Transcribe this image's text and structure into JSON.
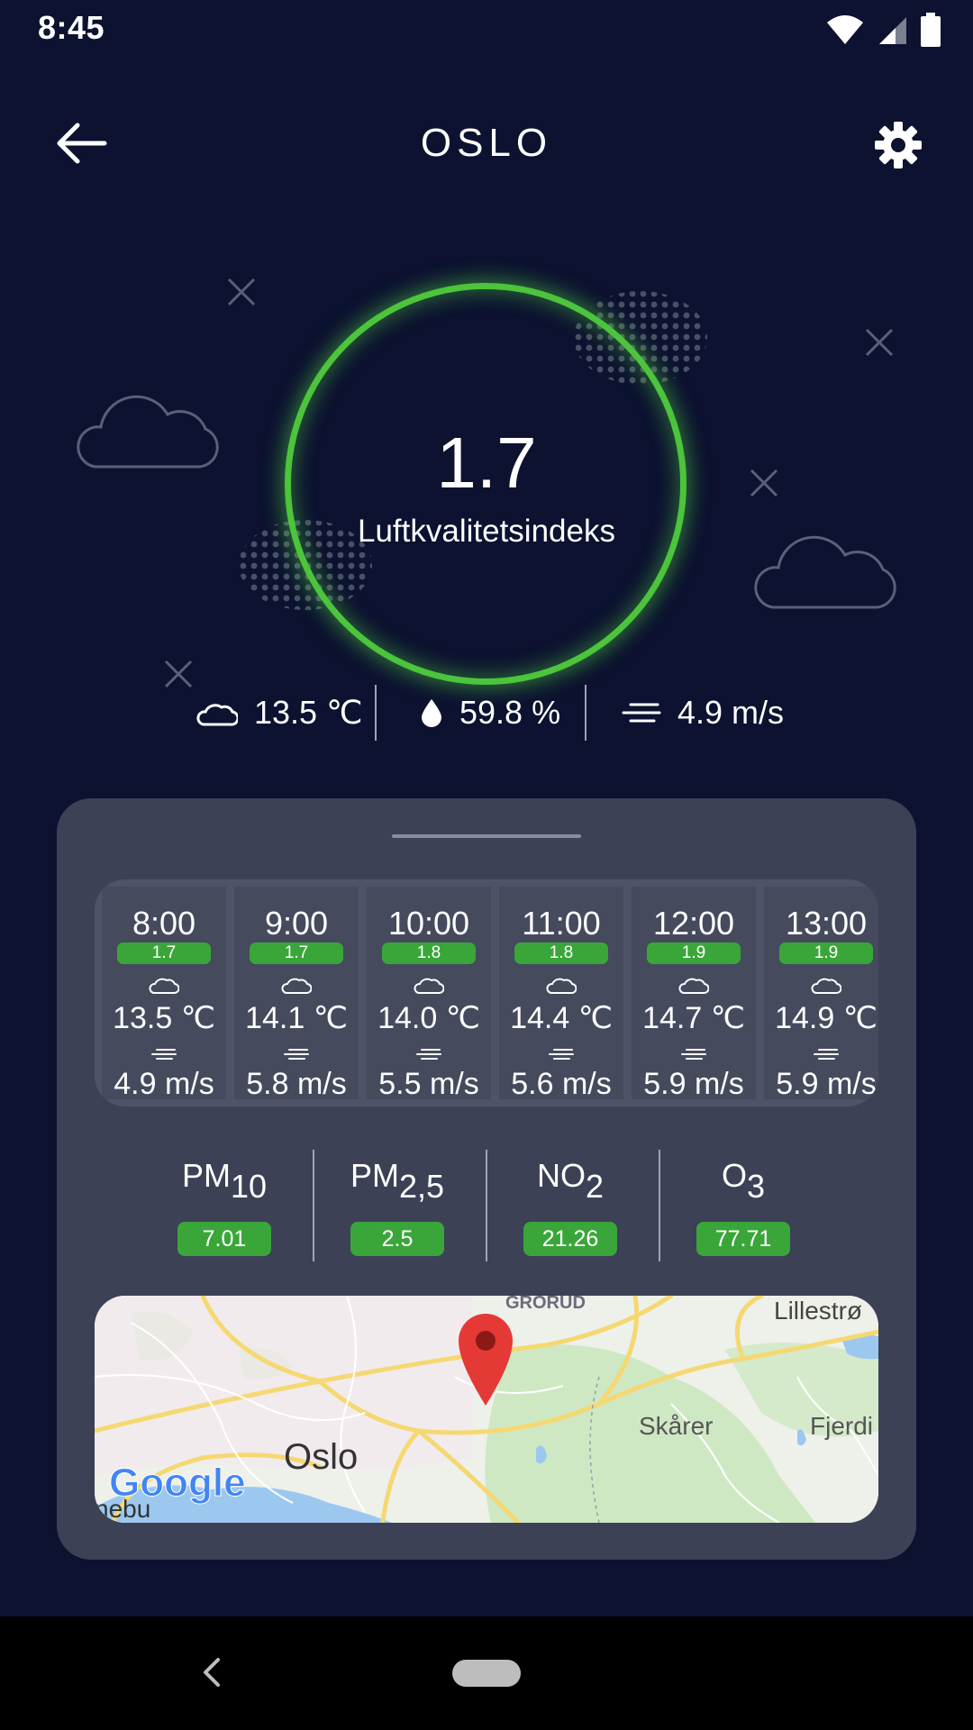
{
  "status_bar": {
    "time": "8:45"
  },
  "app_bar": {
    "title": "OSLO",
    "back_icon": "arrow-left-icon",
    "settings_icon": "gear-icon"
  },
  "aqi": {
    "value": "1.7",
    "label": "Luftkvalitetsindeks",
    "ring_color": "#4cc43c"
  },
  "weather": {
    "temperature": "13.5 ℃",
    "humidity": "59.8 %",
    "wind": "4.9 m/s"
  },
  "forecast": [
    {
      "time": "8:00",
      "aqi": "1.7",
      "temp": "13.5 ℃",
      "wind": "4.9 m/s"
    },
    {
      "time": "9:00",
      "aqi": "1.7",
      "temp": "14.1 ℃",
      "wind": "5.8 m/s"
    },
    {
      "time": "10:00",
      "aqi": "1.8",
      "temp": "14.0 ℃",
      "wind": "5.5 m/s"
    },
    {
      "time": "11:00",
      "aqi": "1.8",
      "temp": "14.4 ℃",
      "wind": "5.6 m/s"
    },
    {
      "time": "12:00",
      "aqi": "1.9",
      "temp": "14.7 ℃",
      "wind": "5.9 m/s"
    },
    {
      "time": "13:00",
      "aqi": "1.9",
      "temp": "14.9 ℃",
      "wind": "5.9 m/s"
    }
  ],
  "pollutants": [
    {
      "name": "PM",
      "sub": "10",
      "value": "7.01"
    },
    {
      "name": "PM",
      "sub": "2,5",
      "value": "2.5"
    },
    {
      "name": "NO",
      "sub": "2",
      "value": "21.26"
    },
    {
      "name": "O",
      "sub": "3",
      "value": "77.71"
    }
  ],
  "map": {
    "labels": {
      "grorud": "GRORUD",
      "lillestrom": "Lillestrø",
      "skarer": "Skårer",
      "oslo": "Oslo",
      "fjerdi": "Fjerdi",
      "nebu": "nebu"
    },
    "google_logo": "Google",
    "pin_color": "#e53935"
  },
  "colors": {
    "background": "#0c1230",
    "panel": "#3c4155",
    "good": "#3aa63a"
  }
}
